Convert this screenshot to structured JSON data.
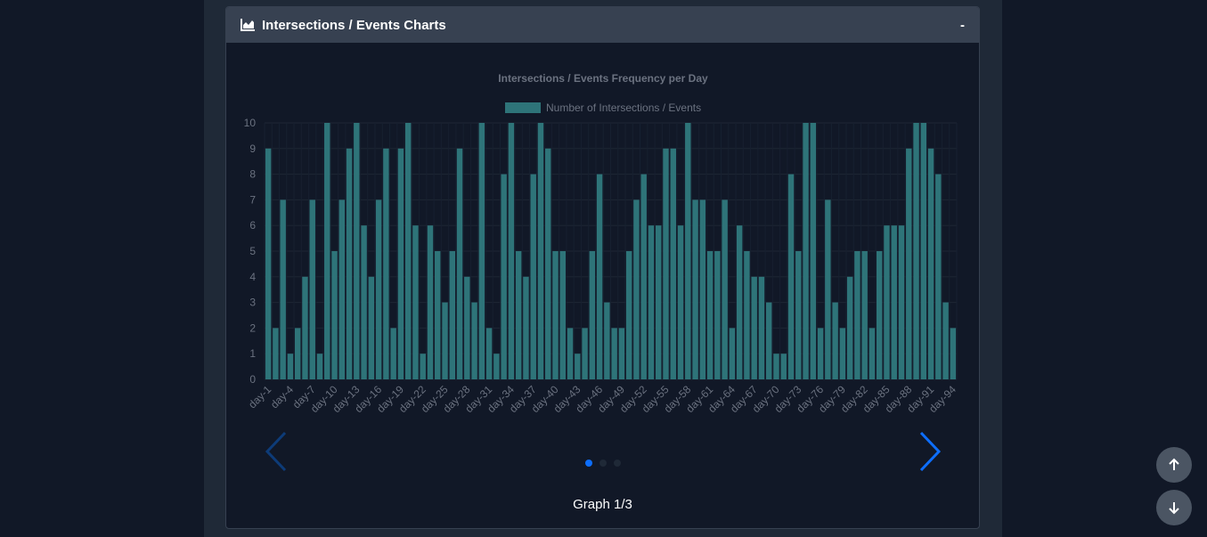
{
  "card": {
    "title": "Intersections / Events Charts",
    "collapse_label": "-",
    "icon": "area-chart-icon"
  },
  "carousel": {
    "caption": "Graph 1/3",
    "active_index": 0,
    "total": 3,
    "prev_icon": "chevron-left-icon",
    "next_icon": "chevron-right-icon"
  },
  "scroll": {
    "up_icon": "arrow-up-icon",
    "down_icon": "arrow-down-icon"
  },
  "colors": {
    "bar": "#2e7479",
    "accent": "#0d6efd",
    "page_bg": "#111827",
    "header_bg": "#374151"
  },
  "chart_data": {
    "type": "bar",
    "title": "Intersections / Events Frequency per Day",
    "legend": "top",
    "ylim": [
      0,
      10
    ],
    "yticks": [
      0,
      1,
      2,
      3,
      4,
      5,
      6,
      7,
      8,
      9,
      10
    ],
    "grid": true,
    "series": [
      {
        "name": "Number of Intersections / Events",
        "values": [
          9,
          2,
          7,
          1,
          2,
          4,
          7,
          1,
          10,
          5,
          7,
          9,
          10,
          6,
          4,
          7,
          9,
          2,
          9,
          10,
          6,
          1,
          6,
          5,
          3,
          5,
          9,
          4,
          3,
          10,
          2,
          1,
          8,
          10,
          5,
          4,
          8,
          10,
          9,
          5,
          5,
          2,
          1,
          2,
          5,
          8,
          3,
          2,
          2,
          5,
          7,
          8,
          6,
          6,
          9,
          9,
          6,
          10,
          7,
          7,
          5,
          5,
          7,
          2,
          6,
          5,
          4,
          4,
          3,
          1,
          1,
          8,
          5,
          10,
          10,
          2,
          7,
          3,
          2,
          4,
          5,
          5,
          2,
          5,
          6,
          6,
          6,
          9,
          10,
          10,
          9,
          8,
          3,
          2
        ]
      }
    ],
    "category_prefix": "day-",
    "category_count": 94,
    "label_every": 3
  }
}
